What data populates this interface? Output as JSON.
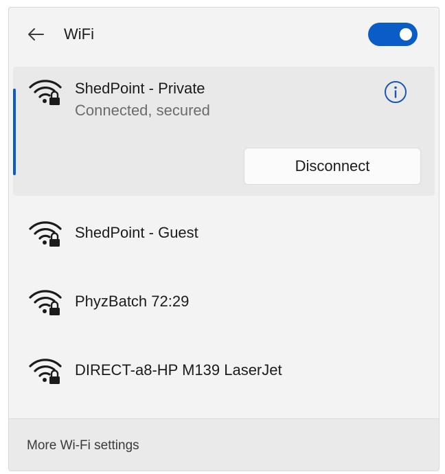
{
  "header": {
    "title": "WiFi",
    "back_icon": "arrow-left-icon",
    "wifi_toggle_on": true
  },
  "networks": [
    {
      "name": "ShedPoint - Private",
      "status": "Connected, secured",
      "icon": "wifi-secured-icon",
      "connected": true
    },
    {
      "name": "ShedPoint - Guest",
      "icon": "wifi-secured-icon"
    },
    {
      "name": "PhyzBatch 72:29",
      "icon": "wifi-secured-icon"
    },
    {
      "name": "DIRECT-a8-HP M139 LaserJet",
      "icon": "wifi-secured-icon"
    }
  ],
  "active_network": {
    "info_icon": "info-icon",
    "disconnect_label": "Disconnect"
  },
  "footer": {
    "more_settings_label": "More Wi-Fi settings"
  },
  "colors": {
    "accent": "#0a5cc7",
    "panel_bg": "#f3f3f3",
    "selected_bg": "#e9e9e9"
  }
}
